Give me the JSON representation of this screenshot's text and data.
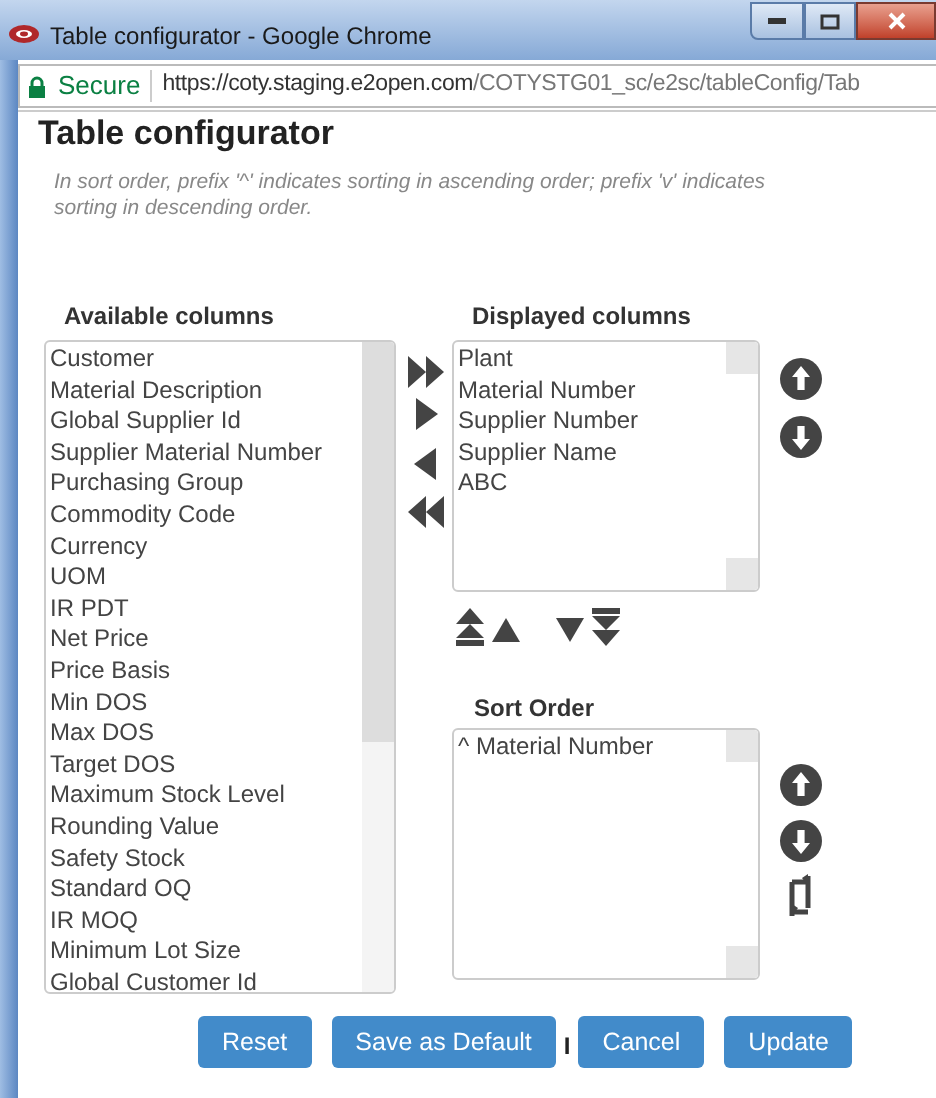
{
  "window": {
    "title": "Table configurator - Google Chrome"
  },
  "address_bar": {
    "security": "Secure",
    "url_host": "https://coty.staging.e2open.com",
    "url_path": "/COTYSTG01_sc/e2sc/tableConfig/Tab"
  },
  "page": {
    "title": "Table configurator",
    "note": "In sort order, prefix '^' indicates sorting in ascending order; prefix 'v' indicates sorting in descending order."
  },
  "available_columns": {
    "heading": "Available columns",
    "items": [
      "Customer",
      "Material Description",
      "Global Supplier Id",
      "Supplier Material Number",
      "Purchasing Group",
      "Commodity Code",
      "Currency",
      "UOM",
      "IR PDT",
      "Net Price",
      "Price Basis",
      "Min DOS",
      "Max DOS",
      "Target DOS",
      "Maximum Stock Level",
      "Rounding Value",
      "Safety Stock",
      "Standard OQ",
      "IR MOQ",
      "Minimum Lot Size",
      "Global Customer Id"
    ]
  },
  "displayed_columns": {
    "heading": "Displayed columns",
    "items": [
      "Plant",
      "Material Number",
      "Supplier Number",
      "Supplier Name",
      "ABC"
    ]
  },
  "sort_order": {
    "heading": "Sort Order",
    "items": [
      "^ Material Number"
    ]
  },
  "buttons": [
    {
      "label": "Reset"
    },
    {
      "label": "Save as Default"
    },
    {
      "label": "Cancel"
    },
    {
      "label": "Update"
    }
  ],
  "separator": "I"
}
